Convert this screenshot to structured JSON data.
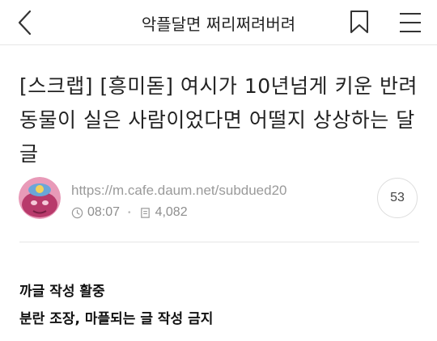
{
  "header": {
    "title": "악플달면 쩌리쩌려버려",
    "back_icon": "chevron-left-icon",
    "bookmark_icon": "bookmark-icon",
    "menu_icon": "hamburger-menu-icon"
  },
  "post": {
    "title": "[스크랩] [흥미돋] 여시가 10년넘게 키운 반려동물이 실은 사람이었다면 어떨지 상상하는 달글",
    "author_url": "https://m.cafe.daum.net/subdued20",
    "time": "08:07",
    "views": "4,082",
    "comment_count": "53",
    "notice_line1": "까글 작성 활중",
    "notice_line2": "분란 조장, 마플되는 글 작성 금지"
  },
  "colors": {
    "text": "#222222",
    "meta": "#8e8e8e",
    "divider": "#e6e6e6",
    "avatar_bg": "#b83a6b"
  }
}
